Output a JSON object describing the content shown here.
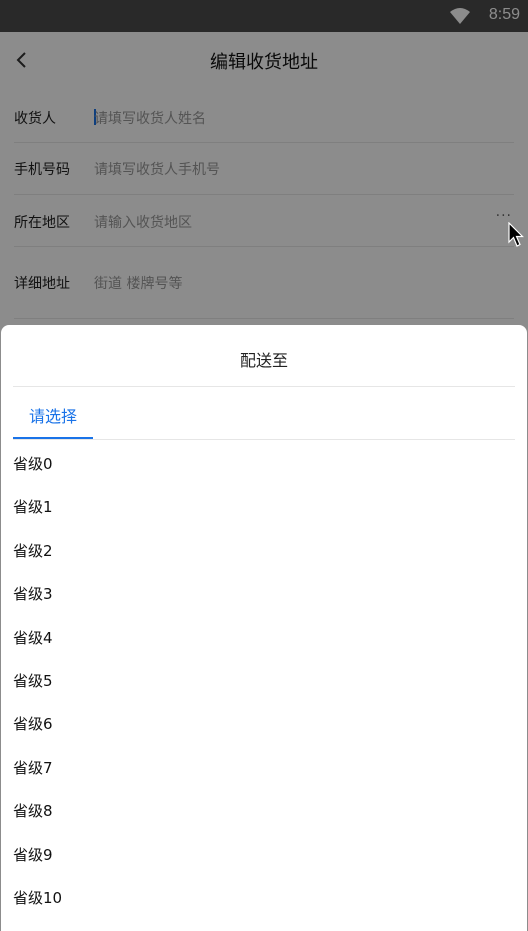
{
  "status_bar": {
    "time": "8:59"
  },
  "header": {
    "title": "编辑收货地址"
  },
  "form": {
    "consignee": {
      "label": "收货人",
      "placeholder": "请填写收货人姓名"
    },
    "phone": {
      "label": "手机号码",
      "placeholder": "请填写收货人手机号"
    },
    "region": {
      "label": "所在地区",
      "placeholder": "请输入收货地区",
      "more": "···"
    },
    "address": {
      "label": "详细地址",
      "placeholder": "街道 楼牌号等"
    }
  },
  "sheet": {
    "title": "配送至",
    "tab_label": "请选择",
    "items": [
      "省级0",
      "省级1",
      "省级2",
      "省级3",
      "省级4",
      "省级5",
      "省级6",
      "省级7",
      "省级8",
      "省级9",
      "省级10"
    ]
  },
  "colors": {
    "accent": "#1a73e8",
    "overlay": "rgba(0,0,0,0.45)",
    "status_bar": "#4b4b4b"
  }
}
